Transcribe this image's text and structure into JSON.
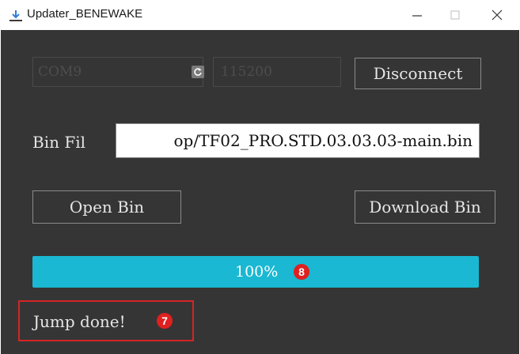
{
  "window": {
    "title": "Updater_BENEWAKE",
    "minimize_glyph": "—",
    "close_glyph": "✕"
  },
  "connection": {
    "port_value": "COM9",
    "baud_value": "115200",
    "disconnect_label": "Disconnect"
  },
  "bin_file": {
    "label": "Bin Fil",
    "path_value": "op/TF02_PRO.STD.03.03.03-main.bin"
  },
  "actions": {
    "open_label": "Open Bin",
    "download_label": "Download Bin"
  },
  "progress": {
    "value_percent": 100,
    "label": "100%",
    "annotation": "8"
  },
  "status": {
    "text": "Jump done!",
    "annotation": "7"
  },
  "colors": {
    "background": "#353535",
    "progress_fill": "#1ab8d2",
    "annotation_red": "#e02020",
    "text_light": "#e6e6e6"
  },
  "icons": {
    "app": "updater-arrow-icon",
    "refresh": "refresh-icon",
    "dropdown": "chevron-down-icon"
  }
}
